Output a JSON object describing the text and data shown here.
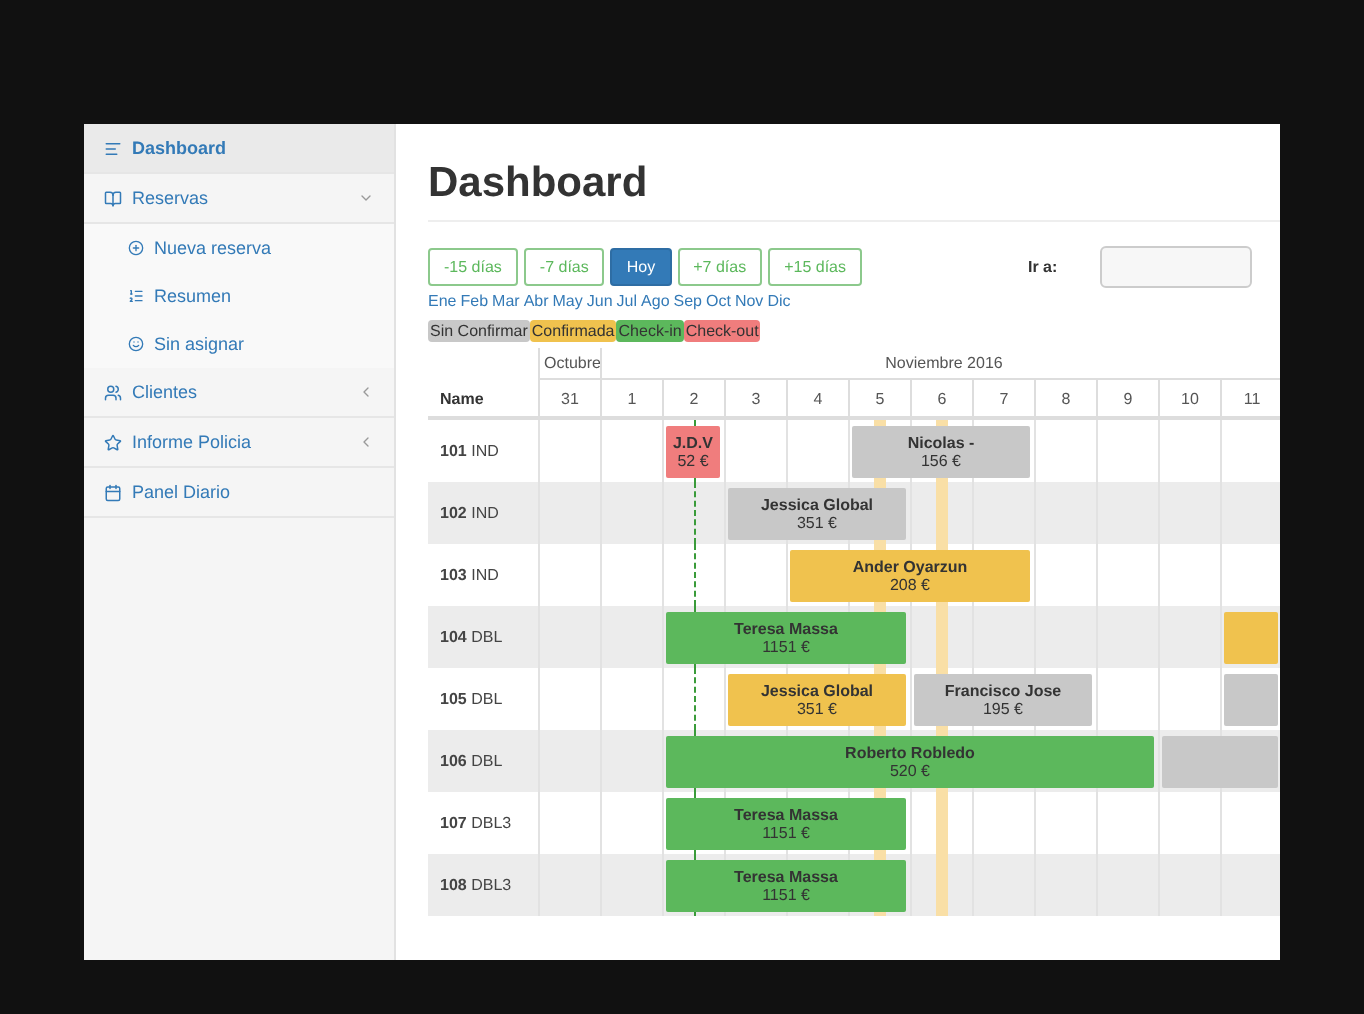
{
  "sidebar": {
    "items": [
      {
        "label": "Dashboard",
        "selected": true
      },
      {
        "label": "Reservas",
        "selected": false,
        "expanded": true,
        "children": [
          {
            "label": "Nueva reserva"
          },
          {
            "label": "Resumen"
          },
          {
            "label": "Sin asignar"
          }
        ]
      },
      {
        "label": "Clientes",
        "selected": false,
        "expanded": false
      },
      {
        "label": "Informe Policia",
        "selected": false,
        "expanded": false
      },
      {
        "label": "Panel Diario",
        "selected": false
      }
    ]
  },
  "page_title": "Dashboard",
  "nav_buttons": [
    {
      "label": "-15 días",
      "selected": false
    },
    {
      "label": "-7 días",
      "selected": false
    },
    {
      "label": "Hoy",
      "selected": true
    },
    {
      "label": "+7 días",
      "selected": false
    },
    {
      "label": "+15 días",
      "selected": false
    }
  ],
  "goto": {
    "label": "Ir a:"
  },
  "months": [
    "Ene",
    "Feb",
    "Mar",
    "Abr",
    "May",
    "Jun",
    "Jul",
    "Ago",
    "Sep",
    "Oct",
    "Nov",
    "Dic"
  ],
  "legend": [
    {
      "label": "Sin Confirmar",
      "color": "#c8c8c8"
    },
    {
      "label": "Confirmada",
      "color": "#f0c24e"
    },
    {
      "label": "Check-in",
      "color": "#5cb85c"
    },
    {
      "label": "Check-out",
      "color": "#f07d7d"
    }
  ],
  "calendar": {
    "name_header": "Name",
    "days": [
      {
        "label": "31",
        "month": "Octubre",
        "today": false,
        "weekend": false
      },
      {
        "label": "1",
        "month": "Noviembre 2016",
        "today": false,
        "weekend": false
      },
      {
        "label": "2",
        "today": true,
        "weekend": false
      },
      {
        "label": "3",
        "today": false,
        "weekend": false
      },
      {
        "label": "4",
        "today": false,
        "weekend": false
      },
      {
        "label": "5",
        "today": false,
        "weekend": true
      },
      {
        "label": "6",
        "today": false,
        "weekend": true
      },
      {
        "label": "7",
        "today": false,
        "weekend": false
      },
      {
        "label": "8",
        "today": false,
        "weekend": false
      },
      {
        "label": "9",
        "today": false,
        "weekend": false
      },
      {
        "label": "10",
        "today": false,
        "weekend": false
      },
      {
        "label": "11",
        "today": false,
        "weekend": false
      }
    ],
    "rooms": [
      {
        "number": "101",
        "type": "IND",
        "cells": [
          {
            "kind": "empty"
          },
          {
            "kind": "empty"
          },
          {
            "kind": "start",
            "color": "#f07d7d",
            "guest": "J.D.V",
            "price": "52 €"
          },
          {
            "kind": "empty"
          },
          {
            "kind": "empty"
          },
          {
            "kind": "start",
            "color": "#c8c8c8",
            "guest": "Nicolas -",
            "price": "156 €"
          },
          {
            "kind": "more"
          },
          {
            "kind": "more"
          },
          {
            "kind": "empty"
          },
          {
            "kind": "empty"
          },
          {
            "kind": "empty"
          },
          {
            "kind": "empty"
          }
        ]
      },
      {
        "number": "102",
        "type": "IND",
        "cells": [
          {
            "kind": "empty"
          },
          {
            "kind": "empty"
          },
          {
            "kind": "empty"
          },
          {
            "kind": "start",
            "color": "#c8c8c8",
            "guest": "Jessica Global",
            "price": "351 €"
          },
          {
            "kind": "more"
          },
          {
            "kind": "more"
          },
          {
            "kind": "empty"
          },
          {
            "kind": "empty"
          },
          {
            "kind": "empty"
          },
          {
            "kind": "empty"
          },
          {
            "kind": "empty"
          },
          {
            "kind": "empty"
          }
        ]
      },
      {
        "number": "103",
        "type": "IND",
        "cells": [
          {
            "kind": "empty"
          },
          {
            "kind": "empty"
          },
          {
            "kind": "empty"
          },
          {
            "kind": "empty"
          },
          {
            "kind": "start",
            "color": "#f0c24e",
            "guest": "Ander Oyarzun",
            "price": "208 €"
          },
          {
            "kind": "more"
          },
          {
            "kind": "more"
          },
          {
            "kind": "more"
          },
          {
            "kind": "empty"
          },
          {
            "kind": "empty"
          },
          {
            "kind": "empty"
          },
          {
            "kind": "empty"
          }
        ]
      },
      {
        "number": "104",
        "type": "DBL",
        "cells": [
          {
            "kind": "empty"
          },
          {
            "kind": "empty"
          },
          {
            "kind": "start",
            "color": "#5cb85c",
            "guest": "Teresa Massa",
            "price": "1151 €"
          },
          {
            "kind": "more"
          },
          {
            "kind": "more"
          },
          {
            "kind": "more"
          },
          {
            "kind": "empty"
          },
          {
            "kind": "empty"
          },
          {
            "kind": "empty"
          },
          {
            "kind": "empty"
          },
          {
            "kind": "empty"
          },
          {
            "kind": "start",
            "color": "#f0c24e"
          }
        ]
      },
      {
        "number": "105",
        "type": "DBL",
        "cells": [
          {
            "kind": "empty"
          },
          {
            "kind": "empty"
          },
          {
            "kind": "empty"
          },
          {
            "kind": "start",
            "color": "#f0c24e",
            "guest": "Jessica Global",
            "price": "351 €"
          },
          {
            "kind": "more"
          },
          {
            "kind": "more"
          },
          {
            "kind": "start",
            "color": "#c8c8c8",
            "guest": "Francisco Jose",
            "price": "195 €"
          },
          {
            "kind": "more"
          },
          {
            "kind": "more"
          },
          {
            "kind": "empty"
          },
          {
            "kind": "empty"
          },
          {
            "kind": "start",
            "color": "#c8c8c8"
          }
        ]
      },
      {
        "number": "106",
        "type": "DBL",
        "cells": [
          {
            "kind": "empty"
          },
          {
            "kind": "empty"
          },
          {
            "kind": "start",
            "color": "#5cb85c",
            "guest": "Roberto Robledo",
            "price": "520 €"
          },
          {
            "kind": "more"
          },
          {
            "kind": "more"
          },
          {
            "kind": "more"
          },
          {
            "kind": "more"
          },
          {
            "kind": "more"
          },
          {
            "kind": "more"
          },
          {
            "kind": "more"
          },
          {
            "kind": "start",
            "color": "#c8c8c8"
          },
          {
            "kind": "more"
          }
        ]
      },
      {
        "number": "107",
        "type": "DBL3",
        "cells": [
          {
            "kind": "empty"
          },
          {
            "kind": "empty"
          },
          {
            "kind": "start",
            "color": "#5cb85c",
            "guest": "Teresa Massa",
            "price": "1151 €"
          },
          {
            "kind": "more"
          },
          {
            "kind": "more"
          },
          {
            "kind": "more"
          },
          {
            "kind": "empty"
          },
          {
            "kind": "empty"
          },
          {
            "kind": "empty"
          },
          {
            "kind": "empty"
          },
          {
            "kind": "empty"
          },
          {
            "kind": "empty"
          }
        ]
      },
      {
        "number": "108",
        "type": "DBL3",
        "cells": [
          {
            "kind": "empty"
          },
          {
            "kind": "empty"
          },
          {
            "kind": "start",
            "color": "#5cb85c",
            "guest": "Teresa Massa",
            "price": "1151 €"
          },
          {
            "kind": "more"
          },
          {
            "kind": "more"
          },
          {
            "kind": "more"
          },
          {
            "kind": "empty"
          },
          {
            "kind": "empty"
          },
          {
            "kind": "empty"
          },
          {
            "kind": "empty"
          },
          {
            "kind": "empty"
          },
          {
            "kind": "empty"
          }
        ]
      }
    ]
  }
}
